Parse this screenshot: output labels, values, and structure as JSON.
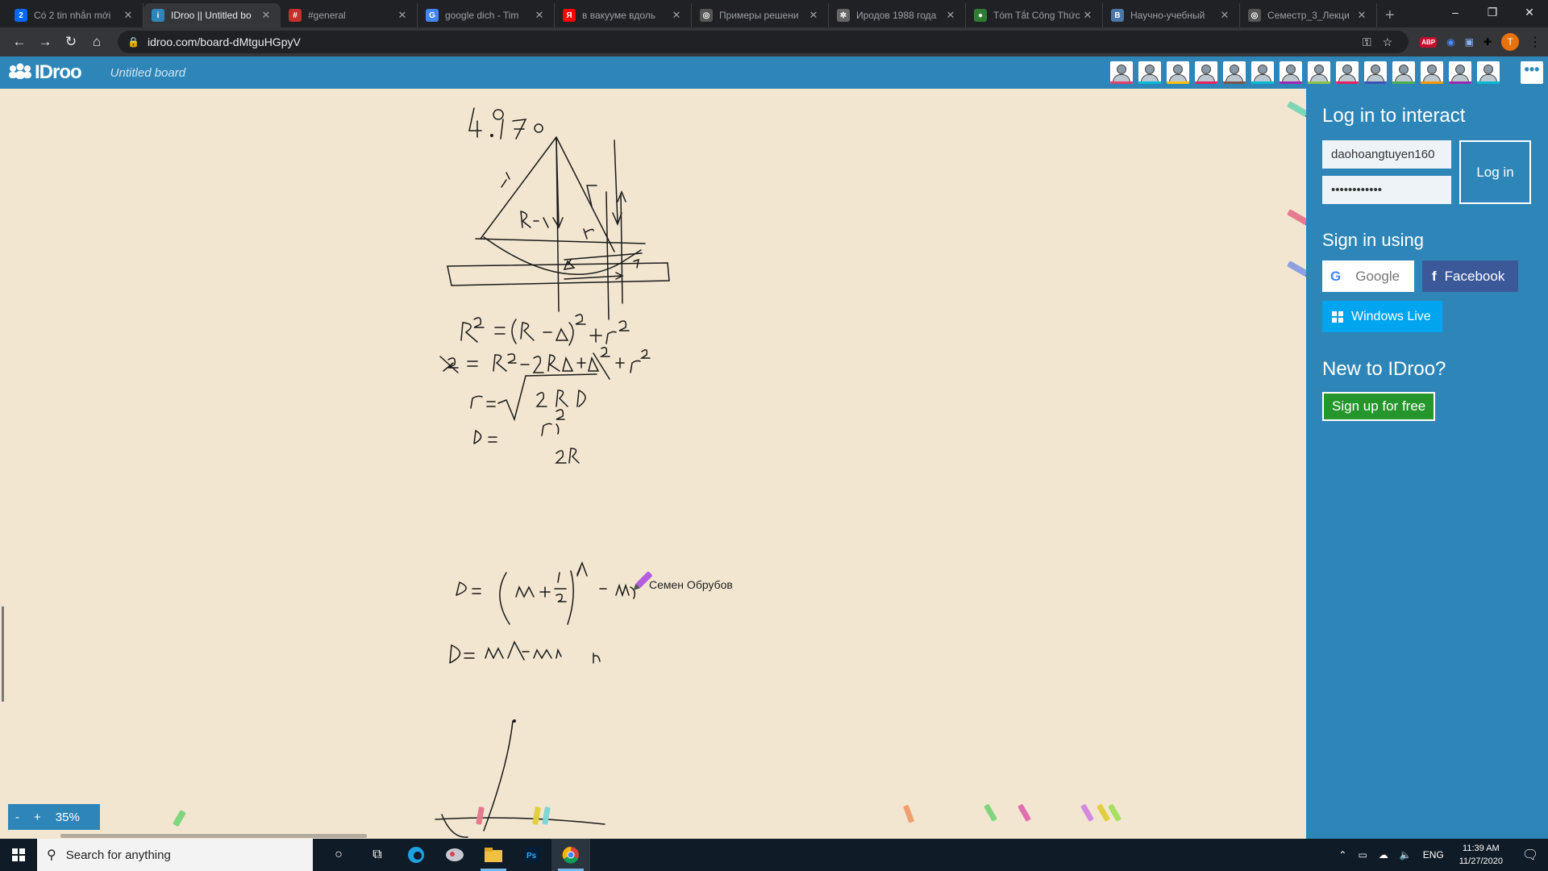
{
  "browser": {
    "tabs": [
      {
        "label": "Có 2 tin nhắn mới",
        "icon": "zalo-icon",
        "color": "#0068ff",
        "glyph": "2"
      },
      {
        "label": "IDroo || Untitled bo",
        "icon": "idroo-icon",
        "color": "#2e86b8",
        "glyph": "i",
        "active": true
      },
      {
        "label": "#general",
        "icon": "discord-icon",
        "color": "#c4302b",
        "glyph": "#"
      },
      {
        "label": "google dich - Tim",
        "icon": "google-icon",
        "color": "#4285f4",
        "glyph": "G"
      },
      {
        "label": "в вакууме вдоль",
        "icon": "yandex-icon",
        "color": "#ff0000",
        "glyph": "Я"
      },
      {
        "label": "Примеры решени",
        "icon": "globe-icon",
        "color": "#555",
        "glyph": "◎"
      },
      {
        "label": "Иродов 1988 года",
        "icon": "gear-site-icon",
        "color": "#666",
        "glyph": "✲"
      },
      {
        "label": "Tóm Tắt Công Thức",
        "icon": "site-icon",
        "color": "#2e7d32",
        "glyph": "●"
      },
      {
        "label": "Научно-учебный",
        "icon": "vk-icon",
        "color": "#4a76a8",
        "glyph": "В"
      },
      {
        "label": "Семестр_3_Лекци",
        "icon": "globe-icon",
        "color": "#555",
        "glyph": "◎"
      }
    ],
    "new_tab": "+",
    "url": "idroo.com/board-dMtguHGpyV"
  },
  "app": {
    "logo": "IDroo",
    "board_name": "Untitled board",
    "avatar_colors": [
      "#e83e6c",
      "#00bcd4",
      "#ffc107",
      "#e91e63",
      "#795548",
      "#00bcd4",
      "#9c27b0",
      "#8bc34a",
      "#e91e63",
      "#3f51b5",
      "#4caf50",
      "#ff9800",
      "#9c27b0",
      "#00bcd4"
    ],
    "menu_label": "•••"
  },
  "board": {
    "cursor_user": "Семен Обрубов",
    "zoom_minus": "-",
    "zoom_plus": "+",
    "zoom_value": "35%"
  },
  "panel": {
    "login_title": "Log in to interact",
    "username": "daohoangtuyen160",
    "password": "••••••••••••",
    "login_button": "Log in",
    "sign_in_title": "Sign in using",
    "google": "Google",
    "facebook": "Facebook",
    "windows_live": "Windows Live",
    "new_title": "New to IDroo?",
    "signup": "Sign up for free"
  },
  "taskbar": {
    "search": "Search for anything",
    "lang": "ENG",
    "time": "11:39 AM",
    "date": "11/27/2020"
  }
}
